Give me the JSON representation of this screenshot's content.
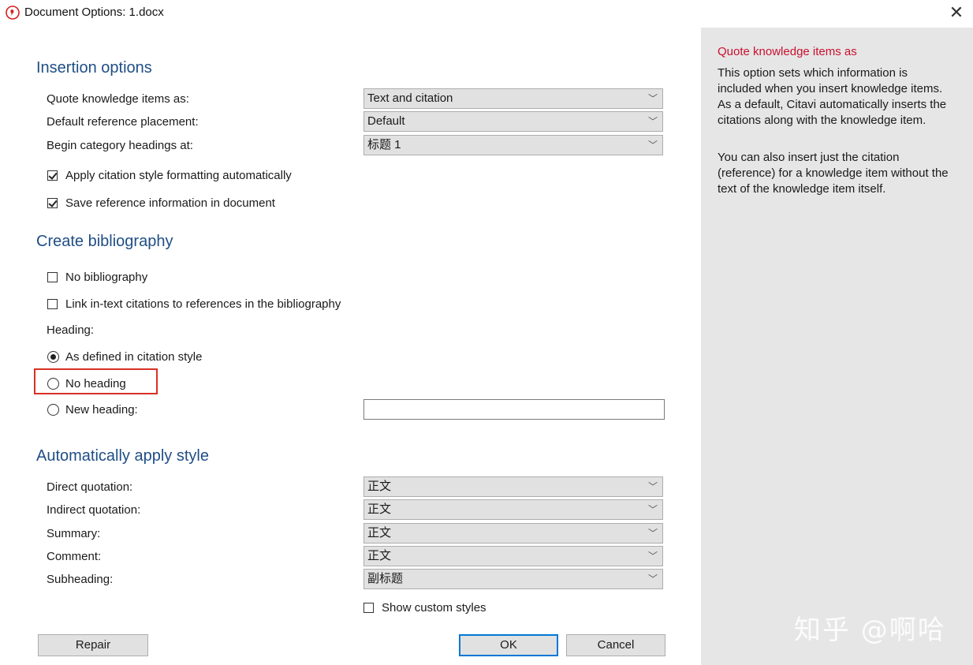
{
  "window": {
    "title": "Document Options: 1.docx",
    "close_glyph": "✕"
  },
  "insertion": {
    "title": "Insertion options",
    "quote_label": "Quote knowledge items as:",
    "quote_value": "Text and citation",
    "placement_label": "Default reference placement:",
    "placement_value": "Default",
    "category_label": "Begin category headings at:",
    "category_value": "标题 1",
    "apply_formatting_label": "Apply citation style formatting automatically",
    "save_reference_label": "Save reference information in document"
  },
  "bibliography": {
    "title": "Create bibliography",
    "no_bibliography_label": "No bibliography",
    "link_citations_label": "Link in-text citations to references in the bibliography",
    "heading_label": "Heading:",
    "as_defined_label": "As defined in citation style",
    "no_heading_label": "No heading",
    "new_heading_label": "New heading:",
    "new_heading_value": ""
  },
  "auto_style": {
    "title": "Automatically apply style",
    "direct_label": "Direct quotation:",
    "direct_value": "正文",
    "indirect_label": "Indirect quotation:",
    "indirect_value": "正文",
    "summary_label": "Summary:",
    "summary_value": "正文",
    "comment_label": "Comment:",
    "comment_value": "正文",
    "subheading_label": "Subheading:",
    "subheading_value": "副标题",
    "show_custom_label": "Show custom styles"
  },
  "buttons": {
    "repair": "Repair",
    "ok": "OK",
    "cancel": "Cancel"
  },
  "help": {
    "title": "Quote knowledge items as",
    "para1": "This option sets which information is included when you insert knowledge items. As a default, Citavi automatically inserts the citations along with the knowledge item.",
    "para2": "You can also insert just the citation (reference) for a knowledge item without the text of the knowledge item itself."
  },
  "watermark": "知乎 @啊哈",
  "colors": {
    "section_title": "#1f4e85",
    "help_title": "#c8102e",
    "highlight": "#d93025",
    "default_button": "#0078d7"
  }
}
